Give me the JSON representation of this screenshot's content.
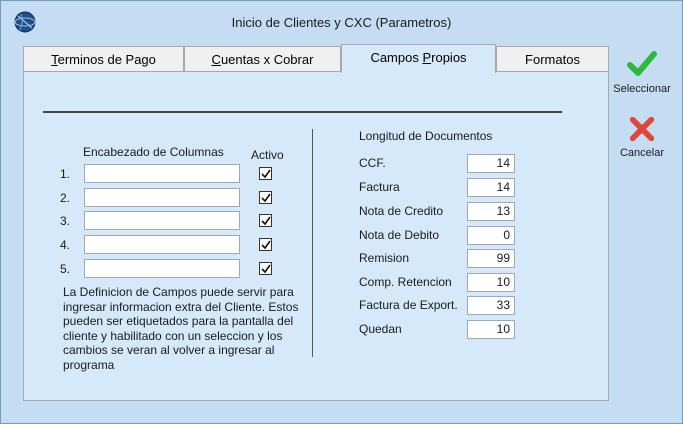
{
  "window": {
    "title": "Inicio de Clientes y CXC (Parametros)"
  },
  "tabs": [
    {
      "label": "Terminos de Pago",
      "mnemonic": "T"
    },
    {
      "label": "Cuentas x Cobrar",
      "mnemonic": "C"
    },
    {
      "label": "Campos Propios",
      "mnemonic": "P"
    },
    {
      "label": "Formatos",
      "mnemonic": ""
    }
  ],
  "active_tab": "Campos Propios",
  "columns_section": {
    "header": "Encabezado de Columnas",
    "active_header": "Activo",
    "rows": [
      {
        "num": "1.",
        "value": "",
        "active": true
      },
      {
        "num": "2.",
        "value": "",
        "active": true
      },
      {
        "num": "3.",
        "value": "",
        "active": true
      },
      {
        "num": "4.",
        "value": "",
        "active": true
      },
      {
        "num": "5.",
        "value": "",
        "active": true
      }
    ],
    "description": "La Definicion de Campos puede servir para ingresar informacion extra del Cliente. Estos pueden ser etiquetados para la pantalla del cliente y habilitado con un seleccion  y los cambios se veran al volver a ingresar al programa"
  },
  "documents_section": {
    "header": "Longitud de Documentos",
    "items": [
      {
        "label": "CCF.",
        "value": "14"
      },
      {
        "label": "Factura",
        "value": "14"
      },
      {
        "label": "Nota de Credito",
        "value": "13"
      },
      {
        "label": "Nota de Debito",
        "value": "0"
      },
      {
        "label": "Remision",
        "value": "99"
      },
      {
        "label": "Comp. Retencion",
        "value": "10"
      },
      {
        "label": "Factura de Export.",
        "value": "33"
      },
      {
        "label": "Quedan",
        "value": "10"
      }
    ]
  },
  "buttons": {
    "select": {
      "label": "Seleccionar",
      "icon": "checkmark-icon",
      "color": "#2fb83a"
    },
    "cancel": {
      "label": "Cancelar",
      "icon": "cross-icon",
      "color": "#e0463a"
    }
  },
  "colors": {
    "window_bg": "#c4ddf3",
    "panel_bg": "#d6e9fb"
  }
}
